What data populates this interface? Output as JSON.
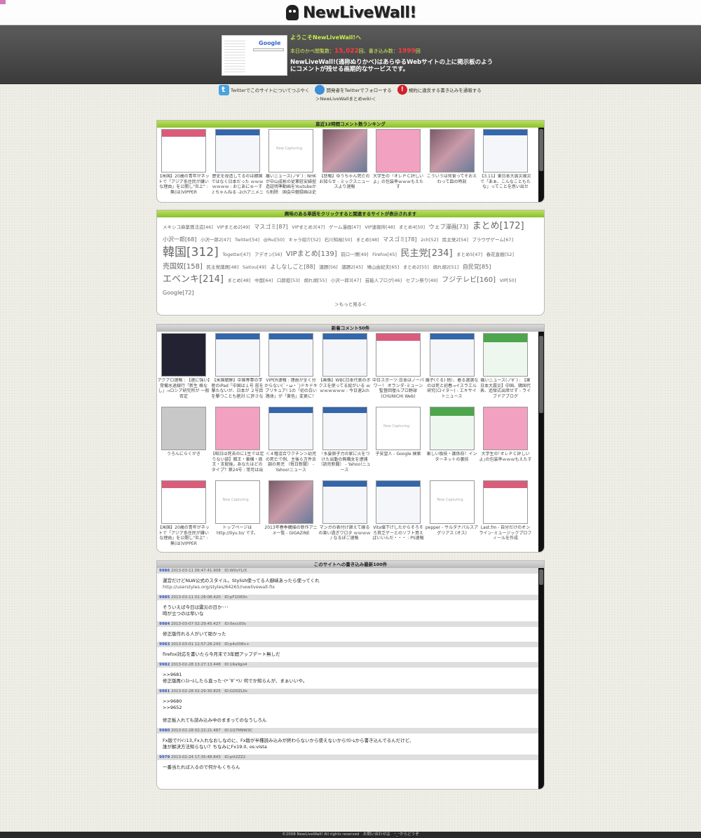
{
  "site": {
    "title": "NewLiveWall!",
    "welcome": "ようこそNewLiveWall!へ",
    "counts_prefix": "本日のかべ閲覧数：",
    "views": "15,022",
    "counts_mid": "回、書き込み数：",
    "posts": "1999",
    "counts_suffix": "回",
    "description": "NewLiveWall!(通称ぬりかべ)はあらゆるWebサイトの上に掲示板のようにコメントが残せる画期的なサービスです。",
    "hero_google": "Google"
  },
  "links": {
    "twitter_site": "Twitterでこのサイトについてつぶやく",
    "twitter_follow": "開発者をTwitterでフォローする",
    "report": "規約に違反する書き込みを通報する",
    "wiki": "＞NewLiveWallまとめwiki＜"
  },
  "ranking": {
    "title": "直近12時間コメント数ランキング",
    "items": [
      {
        "caption": "【米国】20歳の青年がネットで「アジア系住民が嫌いな理由」を公開し\"炎上\" : 無(は)VIPPER",
        "style": "red"
      },
      {
        "caption": "歴史を捏造してるのは韓国ではなく日本だった ｗｗｗｗｗｗｗ : おじあにゅーすｚちゃんねる -2chアニメニュー-",
        "style": "blue"
      },
      {
        "caption": "痛いニュース(ノ∀`) : NHKが中山成彬の従軍慰安婦捏造証明準動画をYoutubeから削除　国会中継録画は史上初 -",
        "style": "light"
      },
      {
        "caption": "【悲報】ゆうちゃん死亡のお知らせ - ミックスニュースより速報",
        "style": "photo"
      },
      {
        "caption": "大学生の「オレＰＣ評しいよ」の包装率ｗｗｗもえたす",
        "style": "pink"
      },
      {
        "caption": "こういうは何食ってそおえわって皿の時刻",
        "style": "photo"
      },
      {
        "caption": "【3.11】東日本大震災被災で「あぁ、こんなこともたな」ってことを思い出せ",
        "style": "blue"
      }
    ]
  },
  "tags": {
    "title": "興味のある単語をクリックすると関連するサイトが表示されます",
    "items": [
      {
        "w": "メキシコ麻薬賞法造",
        "n": "46",
        "s": 1
      },
      {
        "w": "VIPまとめ2",
        "n": "49",
        "s": 1
      },
      {
        "w": "マスゴミ",
        "n": "87",
        "s": 2
      },
      {
        "w": "VIPまとめ3",
        "n": "47",
        "s": 1
      },
      {
        "w": "ゲーム漫画",
        "n": "47",
        "s": 1
      },
      {
        "w": "VIP速報所",
        "n": "48",
        "s": 1
      },
      {
        "w": "まとめ4",
        "n": "50",
        "s": 1
      },
      {
        "w": "ウェブ漫画",
        "n": "73",
        "s": 2
      },
      {
        "w": "まとめ",
        "n": "172",
        "s": 4
      },
      {
        "w": "小沢一郎",
        "n": "68",
        "s": 2
      },
      {
        "w": "小沢一郎2",
        "n": "47",
        "s": 1
      },
      {
        "w": "Twitter",
        "n": "54",
        "s": 1
      },
      {
        "w": "@Rui",
        "n": "50",
        "s": 1
      },
      {
        "w": "キャラ紹介",
        "n": "52",
        "s": 1
      },
      {
        "w": "石川知裕",
        "n": "50",
        "s": 1
      },
      {
        "w": "まとめ",
        "n": "48",
        "s": 1
      },
      {
        "w": "マスゴミ",
        "n": "78",
        "s": 2
      },
      {
        "w": "2ch",
        "n": "52",
        "s": 1
      },
      {
        "w": "民主党2",
        "n": "54",
        "s": 1
      },
      {
        "w": "ブラウザゲーム",
        "n": "67",
        "s": 1
      },
      {
        "w": "韓国",
        "n": "312",
        "s": 5
      },
      {
        "w": "Togetter",
        "n": "47",
        "s": 1
      },
      {
        "w": "アデオン",
        "n": "56",
        "s": 1
      },
      {
        "w": "VIPまとめ",
        "n": "139",
        "s": 3
      },
      {
        "w": "前口一博",
        "n": "49",
        "s": 1
      },
      {
        "w": "Firefox",
        "n": "45",
        "s": 1
      },
      {
        "w": "民主党",
        "n": "234",
        "s": 4
      },
      {
        "w": "まとめ5",
        "n": "47",
        "s": 1
      },
      {
        "w": "春花直樹",
        "n": "52",
        "s": 1
      },
      {
        "w": "売国奴",
        "n": "158",
        "s": 3
      },
      {
        "w": "民主党議員",
        "n": "48",
        "s": 1
      },
      {
        "w": "Saitou",
        "n": "49",
        "s": 1
      },
      {
        "w": "よしなしごと",
        "n": "88",
        "s": 2
      },
      {
        "w": "議題",
        "n": "56",
        "s": 1
      },
      {
        "w": "議題2",
        "n": "45",
        "s": 1
      },
      {
        "w": "鳩山由紀夫",
        "n": "65",
        "s": 1
      },
      {
        "w": "まとめ2",
        "n": "55",
        "s": 1
      },
      {
        "w": "胡れ胡2",
        "n": "51",
        "s": 1
      },
      {
        "w": "自民党",
        "n": "85",
        "s": 2
      },
      {
        "w": "エベンキ",
        "n": "214",
        "s": 4
      },
      {
        "w": "まとめ",
        "n": "48",
        "s": 1
      },
      {
        "w": "中国",
        "n": "64",
        "s": 1
      },
      {
        "w": "口蹄疫",
        "n": "53",
        "s": 1
      },
      {
        "w": "胡れ胡",
        "n": "55",
        "s": 1
      },
      {
        "w": "小沢一郎3",
        "n": "47",
        "s": 1
      },
      {
        "w": "芸能人ブログ",
        "n": "46",
        "s": 1
      },
      {
        "w": "セブン祭り",
        "n": "49",
        "s": 1
      },
      {
        "w": "フジテレビ",
        "n": "160",
        "s": 3
      },
      {
        "w": "VIP",
        "n": "50",
        "s": 1
      },
      {
        "w": "Google",
        "n": "72",
        "s": 2
      }
    ],
    "more": "＞もっと見る＜"
  },
  "recent": {
    "title": "新着コメント50件",
    "items": [
      {
        "caption": "アクアロ速報 : 【速に強い】常備水退線行「新生 格なし」→ロシア研究所が 一般否定",
        "style": "dark"
      },
      {
        "caption": "【米国朝鮮】中国専軍の学者のiPad「中国は１号 前を撃たないが、日本が ２号目を撃つことも絶対 に許さない」→ 大概石弾",
        "style": "blue"
      },
      {
        "caption": "VIPER速報 : 理由が全く分からない(´・ω・`)ドキドキプリキュア! 1の「初の白い路体」が「黄色」変更に！",
        "style": "blue"
      },
      {
        "caption": "【画像】WBC日本代表のボクスを使ってる奴がいる ｗｗｗｗｗｗｗ : 今日速2ch",
        "style": "blue"
      },
      {
        "caption": "中日スポーツ:日本はノーパワー！ オランダ･ミューン監督回復ルプロ野球 (CHUNICHI Web)",
        "style": "red"
      },
      {
        "caption": "痛子(ぐる) 他）、着る選選なのは死と初春→イスラエル研究(ロイター) ‐ エキサイトニュース",
        "style": "blue"
      },
      {
        "caption": "痛いニュース(ノ∀`) : 【東日本大震災】中国、韓国代表、追悼式出席せず ‐ ライブドアブログ",
        "style": "green"
      },
      {
        "caption": "うろんにらくがき",
        "style": "gray"
      },
      {
        "caption": "【昭日は死去のに1生では足りない部】雑王・東横・周王・支配後。あなたはどのタイプ？第24号 : 常可は出来のニュアンス等",
        "style": "pink"
      },
      {
        "caption": "＜４種混合ワクチン＞幼児の死亡で例、主後６万件余調の男児 （毎日新聞） - Yahoo!ニュース",
        "style": "blue"
      },
      {
        "caption": "「水要原子力の家に火をつけた出勤の無職女を逮捕（読売新聞） - Yahoo!ニュース",
        "style": "blue"
      },
      {
        "caption": "子安望人 - Google 検索",
        "style": "light"
      },
      {
        "caption": "東しい板枝・護係前！インターネットの裏技",
        "style": "green"
      },
      {
        "caption": "大学生の｢オレＰＣ評しいよ｣の包装率ｗｗｗもえたす",
        "style": "pink"
      },
      {
        "caption": "【米国】20歳の青年がネットで「アジア系住民が嫌いな理由」を公開し\"炎上\" : 無(は)VIPPER",
        "style": "red"
      },
      {
        "caption": "トップページは http://tiyu.to/ です。",
        "style": "light"
      },
      {
        "caption": "2013年春季購描の新作アニメ一覧 - GIGAZINE",
        "style": "photo"
      },
      {
        "caption": "マンガの表付け諦えて線るの楽い過ぎワロタ ｗｗｗｗ / なるぽご速報",
        "style": "blue"
      },
      {
        "caption": "Vita値下げしたからそろそろ貧乏ゲーとのソフト買えばいいんだ・・・ : PS速報",
        "style": "blue"
      },
      {
        "caption": "pepper - サルダナパルスアグリアス (オス)",
        "style": "light"
      },
      {
        "caption": "Last.fm - 自分だけのオンライン･ミュージックプロフィールを作成",
        "style": "red"
      }
    ]
  },
  "board": {
    "title": "このサイトへの書き込み最新100件",
    "posts": [
      {
        "no": "9986",
        "meta": "2013-03-11 06:47:41.908　ID:W0vYL/X",
        "lines": [
          "運営だけどNLW公式のスタイル。Stylish使ってる人御峡あったら使ってくれ",
          "http://userstyles.org/styles/84265/newlivewall-fix"
        ]
      },
      {
        "no": "9985",
        "meta": "2013-03-11 01:28:08.420　ID:pF1D83n",
        "lines": [
          "そういえば今日は震災の日か･･･",
          "時が立つのは早いな"
        ]
      },
      {
        "no": "9984",
        "meta": "2013-03-07 02:29:45.427　ID:0ecc00s",
        "lines": [
          "修正版作れる人がいて助かった"
        ]
      },
      {
        "no": "9983",
        "meta": "2013-03-01 12:57:28.243　ID:p4vDWv+",
        "lines": [
          "firefox対応を書いたら今月末で3年間アップデート無しだ"
        ]
      },
      {
        "no": "9982",
        "meta": "2013-02-28 13:27:13.448　ID:1Ra9go4",
        "lines": [
          ">>9681",
          "修正版再ｲﾝｽﾄｰﾙしたら直った･(*´∀`*)ﾉ 何でか知らんが、まぁいいや。"
        ]
      },
      {
        "no": "9981",
        "meta": "2013-02-28 02:29:30.825　ID:GD0ZL0c",
        "lines": [
          ">>9680",
          ">>9652",
          "",
          "修正板入れても読み込み中のままってのなうしろん"
        ]
      },
      {
        "no": "9980",
        "meta": "2013-02-28 02:22:21.487　ID:1Q7M9W3C",
        "lines": [
          "Fx版でｸﾗｲﾝ13､Fx入れなおしなのに、Fx版が半種読み込みが終わらないから使えないからｸﾛｰﾑから書き込んでるんだけど、",
          "誰が解決方法知らない？ちなみにFx19.0, os:vista"
        ]
      },
      {
        "no": "9979",
        "meta": "2013-02-24 17:35:48.843　ID:ptt2ZZ2",
        "lines": [
          "一番当たれば入るので何かもくちらん"
        ]
      }
    ]
  },
  "footer": {
    "text": "©2008 NewLiveWall! All rights reserved　お問い合わせは　ｰ_ｰからどうぞ"
  }
}
